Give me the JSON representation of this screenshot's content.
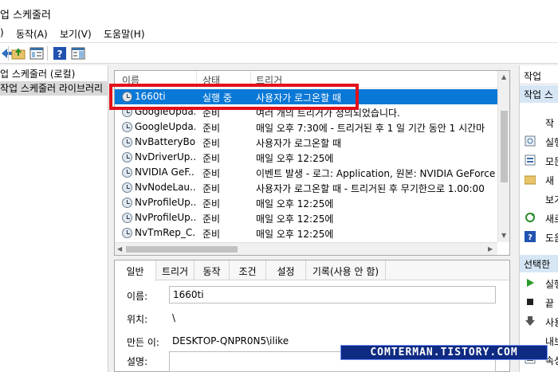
{
  "window": {
    "title": "업 스케줄러"
  },
  "menu": {
    "file": ")",
    "action": "동작(A)",
    "view": "보기(V)",
    "help": "도움말(H)"
  },
  "tree": {
    "root": "업 스케줄러 (로컬)",
    "library": "작업 스케줄러 라이브러리"
  },
  "list": {
    "columns": {
      "name": "이름",
      "state": "상태",
      "trigger": "트리거"
    },
    "rows": [
      {
        "name": "1660ti",
        "state": "실행 중",
        "trigger": "사용자가 로그온할 때"
      },
      {
        "name": "GoogleUpda...",
        "state": "준비",
        "trigger": "여러 개의 트리거가 정의되었습니다."
      },
      {
        "name": "GoogleUpda...",
        "state": "준비",
        "trigger": "매일 오후 7:30에 - 트리거된 후 1 일 기간 동안 1 시간마"
      },
      {
        "name": "NvBatteryBo...",
        "state": "준비",
        "trigger": "사용자가 로그온할 때"
      },
      {
        "name": "NvDriverUp...",
        "state": "준비",
        "trigger": "매일 오후 12:25에"
      },
      {
        "name": "NVIDIA GeF...",
        "state": "준비",
        "trigger": "이벤트 발생 - 로그: Application, 원본: NVIDIA GeForce E"
      },
      {
        "name": "NvNodeLau...",
        "state": "준비",
        "trigger": "사용자가 로그온할 때 - 트리거된 후 무기한으로 1.00:00"
      },
      {
        "name": "NvProfileUp...",
        "state": "준비",
        "trigger": "매일 오후 12:25에"
      },
      {
        "name": "NvProfileUp...",
        "state": "준비",
        "trigger": "매일 오후 12:25에"
      },
      {
        "name": "NvTmRep_C...",
        "state": "준비",
        "trigger": "매일 오후 12:25에"
      }
    ]
  },
  "detail": {
    "tabs": [
      "일반",
      "트리거",
      "동작",
      "조건",
      "설정",
      "기록(사용 안 함)"
    ],
    "name_label": "이름:",
    "name_value": "1660ti",
    "location_label": "위치:",
    "location_value": "\\",
    "author_label": "만든 이:",
    "author_value": "DESKTOP-QNPR0N5\\ilike",
    "desc_label": "설명:"
  },
  "actions": {
    "header": "작업",
    "section1": "작업 스",
    "items1": [
      "작",
      "실행",
      "모든",
      "새",
      "보기",
      "새로",
      "도움"
    ],
    "section2": "선택한",
    "items2": [
      "실행",
      "끝",
      "사용",
      "내보",
      "속성"
    ]
  },
  "watermark": "COMTERMAN.TISTORY.COM"
}
